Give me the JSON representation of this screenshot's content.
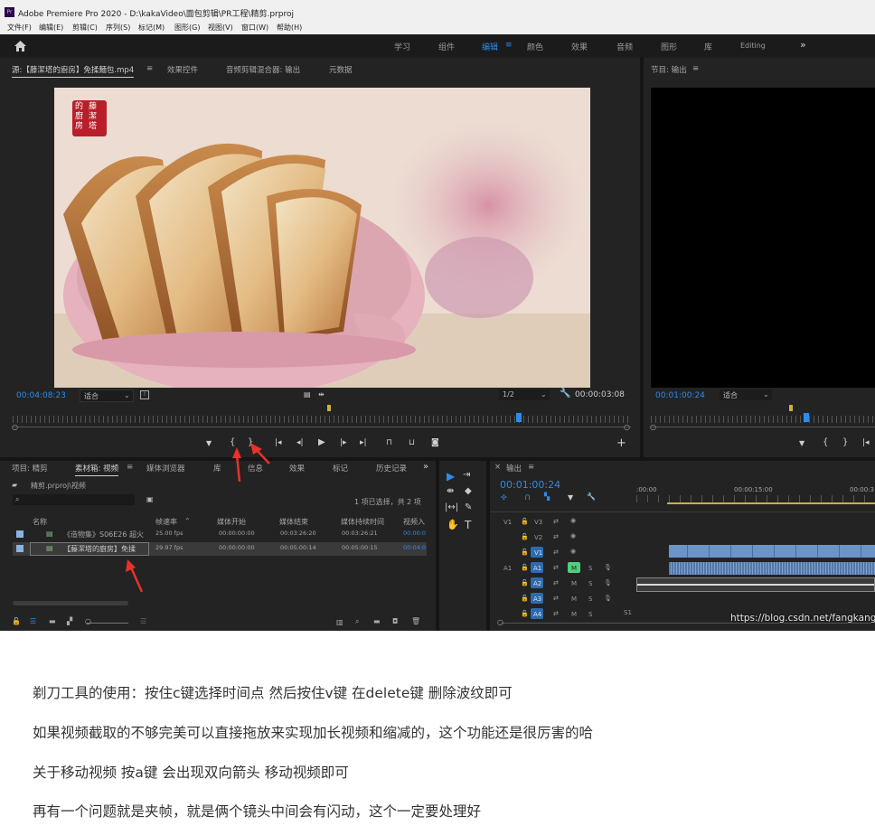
{
  "window": {
    "title": "Adobe Premiere Pro 2020 - D:\\kakaVideo\\面包剪辑\\PR工程\\精剪.prproj"
  },
  "menu": [
    "文件(F)",
    "编辑(E)",
    "剪辑(C)",
    "序列(S)",
    "标记(M)",
    "图形(G)",
    "视图(V)",
    "窗口(W)",
    "帮助(H)"
  ],
  "workspaces": {
    "items": [
      "学习",
      "组件",
      "编辑",
      "颜色",
      "效果",
      "音频",
      "图形",
      "库",
      "Editing"
    ],
    "active": "编辑",
    "more": "»"
  },
  "source_panel": {
    "tabs": [
      "源:【藤潔塔的廚房】免揉麵包.mp4",
      "效果控件",
      "音频剪辑混合器: 输出",
      "元数据"
    ],
    "menu_icon": "≡",
    "watermark": [
      "藤",
      "潔",
      "塔",
      "的",
      "廚",
      "房"
    ],
    "timecode_left": "00:04:08:23",
    "fit": "适合",
    "res": "1/2",
    "timecode_right": "00:00:03:08"
  },
  "program_panel": {
    "title": "节目: 输出",
    "menu_icon": "≡",
    "timecode": "00:01:00:24",
    "fit": "适合"
  },
  "project_panel": {
    "tabs": [
      "项目: 精剪",
      "素材箱: 视频",
      "媒体浏览器",
      "库",
      "信息",
      "效果",
      "标记",
      "历史记录"
    ],
    "breadcrumb": "精剪.prproj\\视频",
    "status": "1 项已选择，共 2 项",
    "columns": [
      "名称",
      "帧速率",
      "媒体开始",
      "媒体结束",
      "媒体持续时间",
      "视频入"
    ],
    "rows": [
      {
        "name": "《造物集》S06E26 超火",
        "fps": "25.00 fps",
        "start": "00:00:00:00",
        "end": "00:03:26:20",
        "dur": "00:03:26:21",
        "in": "00:00:0"
      },
      {
        "name": "【藤潔塔的廚房】免揉",
        "fps": "29.97 fps",
        "start": "00:00:00:00",
        "end": "00:05:00:14",
        "dur": "00:05:00:15",
        "in": "00:04:0"
      }
    ]
  },
  "timeline_panel": {
    "title": "输出",
    "timecode": "00:01:00:24",
    "ruler": [
      ":00:00",
      "00:00:15:00",
      "00:00:3"
    ],
    "tracks": [
      "V3",
      "V2",
      "V1",
      "A1",
      "A2",
      "A3",
      "A4"
    ],
    "a1_label": "A1",
    "v1_label": "V1",
    "m": "M",
    "s": "S",
    "mix_label": "S1"
  },
  "watermark_url": "https://blog.csdn.net/fangkang7",
  "article": [
    "剃刀工具的使用：按住c键选择时间点 然后按住v键 在delete键 删除波纹即可",
    "如果视频截取的不够完美可以直接拖放来实现加长视频和缩减的，这个功能还是很厉害的哈",
    "关于移动视频 按a键 会出现双向箭头 移动视频即可",
    "再有一个问题就是夹帧，就是俩个镜头中间会有闪动，这个一定要处理好"
  ],
  "colors": {
    "accent": "#2d8ceb",
    "panel": "#232323",
    "annotation": "#e8322a"
  }
}
